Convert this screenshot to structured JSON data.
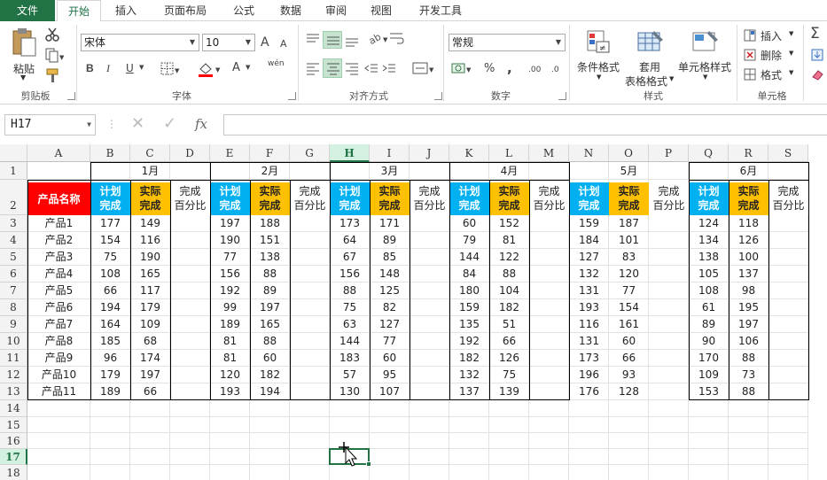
{
  "ribbon_tabs": [
    "文件",
    "开始",
    "插入",
    "页面布局",
    "公式",
    "数据",
    "审阅",
    "视图",
    "开发工具"
  ],
  "active_tab": "开始",
  "clipboard": {
    "paste_label": "粘贴",
    "group_label": "剪贴板"
  },
  "font": {
    "name": "宋体",
    "size": "10",
    "group_label": "字体",
    "bold": "B",
    "italic": "I",
    "underline": "U",
    "grow": "A",
    "shrink": "A",
    "font_color": "A",
    "phonetic": "wén"
  },
  "alignment": {
    "group_label": "对齐方式"
  },
  "number": {
    "format": "常规",
    "group_label": "数字",
    "percent": "%",
    "comma": ",",
    "inc_decimal": ".00",
    "dec_decimal": ".0"
  },
  "styles": {
    "conditional_label": "条件格式",
    "table_label_1": "套用",
    "table_label_2": "表格格式",
    "cell_styles_label": "单元格样式",
    "group_label": "样式"
  },
  "cells": {
    "insert_label": "插入",
    "delete_label": "删除",
    "format_label": "格式",
    "group_label": "单元格"
  },
  "editing": {
    "sum_symbol": "Σ"
  },
  "formula_bar": {
    "name_box": "H17",
    "fx": "fx",
    "formula": ""
  },
  "columns": [
    "A",
    "B",
    "C",
    "D",
    "E",
    "F",
    "G",
    "H",
    "I",
    "J",
    "K",
    "L",
    "M",
    "N",
    "O",
    "P",
    "Q",
    "R",
    "S"
  ],
  "rows": [
    "1",
    "2",
    "3",
    "4",
    "5",
    "6",
    "7",
    "8",
    "9",
    "10",
    "11",
    "12",
    "13",
    "14",
    "15",
    "16",
    "17",
    "18"
  ],
  "selected_col": "H",
  "selected_row": "17",
  "months": [
    "1月",
    "2月",
    "3月",
    "4月",
    "5月",
    "6月"
  ],
  "header": {
    "product": "产品名称",
    "plan_1": "计划",
    "plan_2": "完成",
    "actual_1": "实际",
    "actual_2": "完成",
    "pct_1": "完成",
    "pct_2": "百分比"
  },
  "table": [
    {
      "name": "产品1",
      "values": [
        [
          177,
          149
        ],
        [
          197,
          188
        ],
        [
          173,
          171
        ],
        [
          60,
          152
        ],
        [
          159,
          187
        ],
        [
          124,
          118
        ]
      ]
    },
    {
      "name": "产品2",
      "values": [
        [
          154,
          116
        ],
        [
          190,
          151
        ],
        [
          64,
          89
        ],
        [
          79,
          81
        ],
        [
          184,
          101
        ],
        [
          134,
          126
        ]
      ]
    },
    {
      "name": "产品3",
      "values": [
        [
          75,
          190
        ],
        [
          77,
          138
        ],
        [
          67,
          85
        ],
        [
          144,
          122
        ],
        [
          127,
          83
        ],
        [
          138,
          100
        ]
      ]
    },
    {
      "name": "产品4",
      "values": [
        [
          108,
          165
        ],
        [
          156,
          88
        ],
        [
          156,
          148
        ],
        [
          84,
          88
        ],
        [
          132,
          120
        ],
        [
          105,
          137
        ]
      ]
    },
    {
      "name": "产品5",
      "values": [
        [
          66,
          117
        ],
        [
          192,
          89
        ],
        [
          88,
          125
        ],
        [
          180,
          104
        ],
        [
          131,
          77
        ],
        [
          108,
          98
        ]
      ]
    },
    {
      "name": "产品6",
      "values": [
        [
          194,
          179
        ],
        [
          99,
          197
        ],
        [
          75,
          82
        ],
        [
          159,
          182
        ],
        [
          193,
          154
        ],
        [
          61,
          195
        ]
      ]
    },
    {
      "name": "产品7",
      "values": [
        [
          164,
          109
        ],
        [
          189,
          165
        ],
        [
          63,
          127
        ],
        [
          135,
          51
        ],
        [
          116,
          161
        ],
        [
          89,
          197
        ]
      ]
    },
    {
      "name": "产品8",
      "values": [
        [
          185,
          68
        ],
        [
          81,
          88
        ],
        [
          144,
          77
        ],
        [
          192,
          66
        ],
        [
          131,
          60
        ],
        [
          90,
          106
        ]
      ]
    },
    {
      "name": "产品9",
      "values": [
        [
          96,
          174
        ],
        [
          81,
          60
        ],
        [
          183,
          60
        ],
        [
          182,
          126
        ],
        [
          173,
          66
        ],
        [
          170,
          88
        ]
      ]
    },
    {
      "name": "产品10",
      "values": [
        [
          179,
          197
        ],
        [
          120,
          182
        ],
        [
          57,
          95
        ],
        [
          132,
          75
        ],
        [
          196,
          93
        ],
        [
          109,
          73
        ]
      ]
    },
    {
      "name": "产品11",
      "values": [
        [
          189,
          66
        ],
        [
          193,
          194
        ],
        [
          130,
          107
        ],
        [
          137,
          139
        ],
        [
          176,
          128
        ],
        [
          153,
          88
        ]
      ]
    }
  ],
  "colors": {
    "excel_green": "#217346",
    "plan_header": "#00b0f0",
    "actual_header": "#ffc000",
    "product_header": "#ff0000",
    "selection": "#217346"
  }
}
